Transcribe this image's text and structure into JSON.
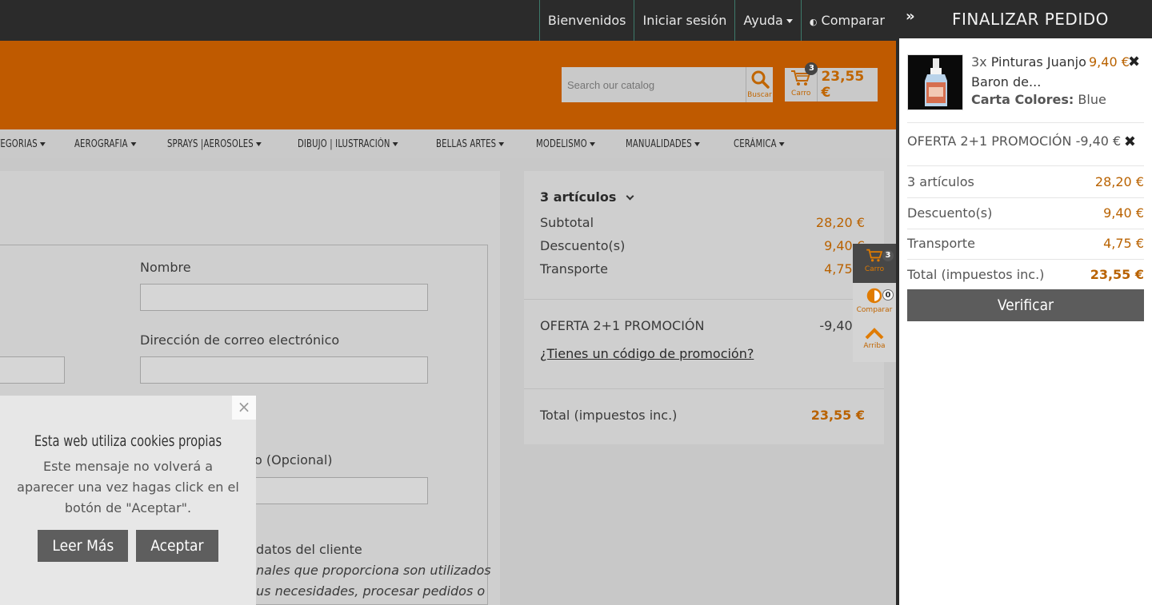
{
  "topnav": {
    "items": [
      "Bienvenidos",
      "Iniciar sesión",
      "Ayuda",
      "Comparar"
    ]
  },
  "header": {
    "search_placeholder": "Search our catalog",
    "search_button": "Buscar",
    "cart_label": "Carro",
    "cart_count": "3",
    "cart_total": "23,55 €"
  },
  "menu": {
    "items": [
      "TEGORIAS",
      "AEROGRAFIA",
      "SPRAYS |AEROSOLES",
      "DIBUJO | ILUSTRACIÓN",
      "BELLAS ARTES",
      "MODELISMO",
      "MANUALIDADES",
      "CERÁMICA"
    ]
  },
  "form": {
    "name_label": "Nombre",
    "email_label": "Dirección de correo electrónico",
    "optional_label": "o (Opcional)",
    "privacy_title": "datos del cliente",
    "privacy_lines": [
      "nales que proporciona son utilizados",
      "us necesidades, procesar pedidos o"
    ]
  },
  "summary": {
    "items_toggle": "3 artículos",
    "subtotal_label": "Subtotal",
    "subtotal_value": "28,20 €",
    "discount_label": "Descuento(s)",
    "discount_value": "9,40 €",
    "shipping_label": "Transporte",
    "shipping_value": "4,75 €",
    "promo_label": "OFERTA 2+1 PROMOCIÓN",
    "promo_value": "-9,40 €",
    "promo_link": "¿Tienes un código de promoción?",
    "total_label": "Total (impuestos inc.)",
    "total_value": "23,55 €"
  },
  "floater": {
    "cart_label": "Carro",
    "cart_count": "3",
    "compare_label": "Comparar",
    "compare_count": "0",
    "top_label": "Arriba"
  },
  "cookie": {
    "title": "Esta web utiliza cookies propias",
    "message": "Este mensaje no volverá a aparecer una vez hagas click en el botón de \"Aceptar\".",
    "more_button": "Leer Más",
    "accept_button": "Aceptar",
    "close": "×"
  },
  "panel": {
    "title": "FINALIZAR PEDIDO",
    "item_qty": "3x",
    "item_name": "Pinturas Juanjo Baron de...",
    "item_price": "9,40 €",
    "item_attr_label": "Carta Colores:",
    "item_attr_value": "Blue",
    "promo_text": "OFERTA 2+1 PROMOCIÓN -9,40 €",
    "rows": [
      {
        "label": "3 artículos",
        "value": "28,20 €"
      },
      {
        "label": "Descuento(s)",
        "value": "9,40 €"
      },
      {
        "label": "Transporte",
        "value": "4,75 €"
      }
    ],
    "total_label": "Total (impuestos inc.)",
    "total_value": "23,55 €",
    "verify_button": "Verificar"
  },
  "colors": {
    "brand_orange": "#bf5a00",
    "price_orange": "#b96200",
    "dark": "#2b2b2b"
  }
}
